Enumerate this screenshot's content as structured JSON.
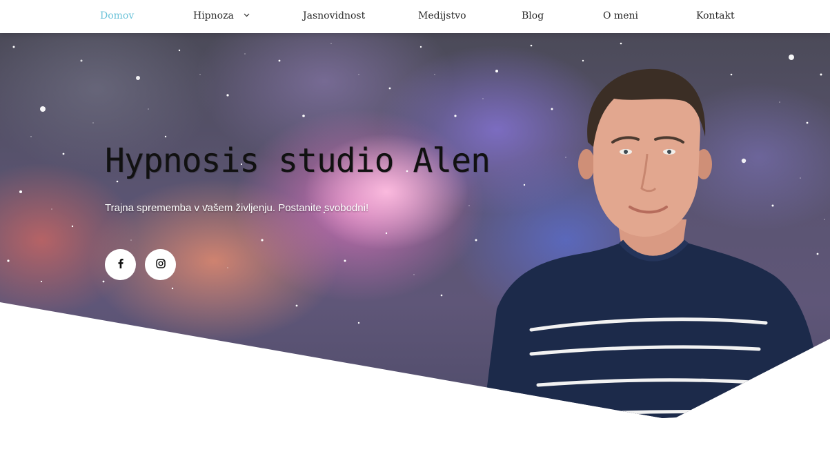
{
  "nav": {
    "items": [
      {
        "label": "Domov",
        "active": true
      },
      {
        "label": "Hipnoza",
        "has_dropdown": true
      },
      {
        "label": "Jasnovidnost"
      },
      {
        "label": "Medijstvo"
      },
      {
        "label": "Blog"
      },
      {
        "label": "O meni"
      },
      {
        "label": "Kontakt"
      }
    ],
    "active_color": "#6cc3d9",
    "dropdown_icon": "chevron-down-icon"
  },
  "hero": {
    "title": "Hypnosis studio Alen",
    "subtitle": "Trajna sprememba v vašem življenju. Postanite svobodni!",
    "social": [
      {
        "network": "facebook",
        "icon": "facebook-icon"
      },
      {
        "network": "instagram",
        "icon": "instagram-icon"
      }
    ],
    "background": "galaxy-nebula",
    "portrait": "man-in-striped-sweater"
  }
}
